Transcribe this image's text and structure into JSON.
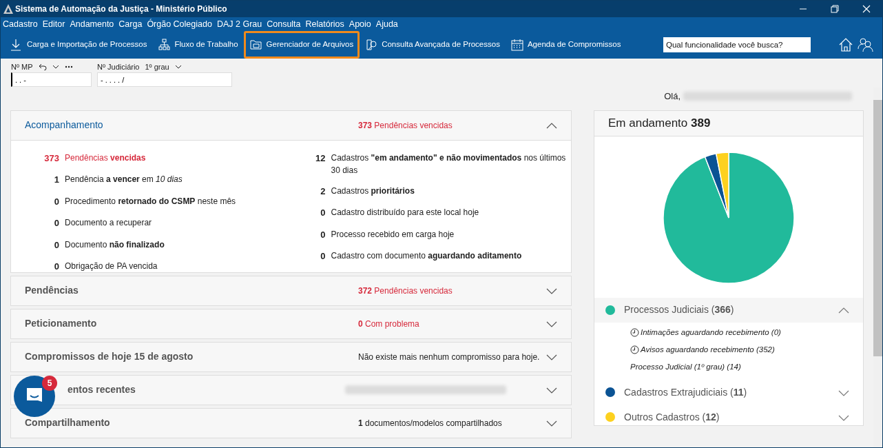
{
  "window": {
    "title": "Sistema de Automação da Justiça - Ministério Público"
  },
  "menu": [
    "Cadastro",
    "Editor",
    "Andamento",
    "Carga",
    "Órgão Colegiado",
    "DAJ 2 Grau",
    "Consulta",
    "Relatórios",
    "Apoio",
    "Ajuda"
  ],
  "toolbar": [
    {
      "label": "Carga e Importação de Processos",
      "highlighted": false
    },
    {
      "label": "Fluxo de Trabalho",
      "highlighted": false
    },
    {
      "label": "Gerenciador de Arquivos",
      "highlighted": true
    },
    {
      "label": "Consulta Avançada de Processos",
      "highlighted": false
    },
    {
      "label": "Agenda de Compromissos",
      "highlighted": false
    }
  ],
  "search": {
    "placeholder": "Qual funcionalidade você busca?"
  },
  "fields": [
    {
      "label": "Nº MP",
      "value": ". . -",
      "focused": true
    },
    {
      "label": "Nº Judiciário",
      "option": "1º grau",
      "value": "- . . . . /",
      "focused": false
    }
  ],
  "greeting": "Olá,",
  "panel": {
    "title": "Acompanhamento",
    "summary": "**373** Pendências vencidas",
    "alert": true,
    "expanded": true,
    "left_items": [
      {
        "count": "373",
        "text": "Pendências **vencidas**",
        "alert": true
      },
      {
        "count": "1",
        "text": "Pendência **a vencer** em *10 dias*",
        "alert": false
      },
      {
        "count": "0",
        "text": "Procedimento **retornado do CSMP** neste mês",
        "alert": false
      },
      {
        "count": "0",
        "text": "Documento a recuperar",
        "alert": false
      },
      {
        "count": "0",
        "text": "Documento **não finalizado**",
        "alert": false
      },
      {
        "count": "0",
        "text": "Obrigação de PA vencida",
        "alert": false
      }
    ],
    "right_items": [
      {
        "count": "12",
        "text": "Cadastros **\"em andamento\" e não movimentados** nos últimos 30 dias",
        "alert": false
      },
      {
        "count": "2",
        "text": "Cadastros **prioritários**",
        "alert": false
      },
      {
        "count": "0",
        "text": "Cadastro distribuído para este local hoje",
        "alert": false
      },
      {
        "count": "0",
        "text": "Processo recebido em carga hoje",
        "alert": false
      },
      {
        "count": "0",
        "text": "Cadastro com documento **aguardando aditamento**",
        "alert": false
      }
    ]
  },
  "sections": [
    {
      "title": "Pendências",
      "summary": "**372** Pendências vencidas",
      "alert": true,
      "expanded": false
    },
    {
      "title": "Peticionamento",
      "summary": "**0** Com problema",
      "alert": true,
      "expanded": false
    },
    {
      "title": "Compromissos de hoje 15 de agosto",
      "summary": "Não existe mais nenhum compromisso para hoje.",
      "alert": false,
      "expanded": false
    },
    {
      "title": "entos recentes",
      "expanded": false
    },
    {
      "title": "Compartilhamento",
      "summary": "**1** documentos/modelos compartilhados",
      "alert": false,
      "expanded": false
    }
  ],
  "chat": {
    "badge": "5"
  },
  "progress": {
    "title": "Em andamento **389**",
    "chart_data": {
      "type": "pie",
      "series": [
        {
          "values": [
            94.09,
            2.83,
            3.08
          ]
        }
      ]
    },
    "legend": [
      {
        "label": "Processos Judiciais (**366**)",
        "color": "#21ba9b",
        "expanded": true,
        "children": [
          {
            "text": "Intimações aguardando recebimento (0)",
            "kind": "pending"
          },
          {
            "text": "Avisos aguardando recebimento (352)",
            "kind": "pending"
          },
          {
            "text": "Processo Judicial (1º grau) (14)",
            "kind": "plain"
          }
        ]
      },
      {
        "label": "Cadastros Extrajudiciais (**11**)",
        "color": "#0b5394",
        "expanded": false
      },
      {
        "label": "Outros Cadastros (**12**)",
        "color": "#fdd11f",
        "expanded": false
      }
    ]
  }
}
